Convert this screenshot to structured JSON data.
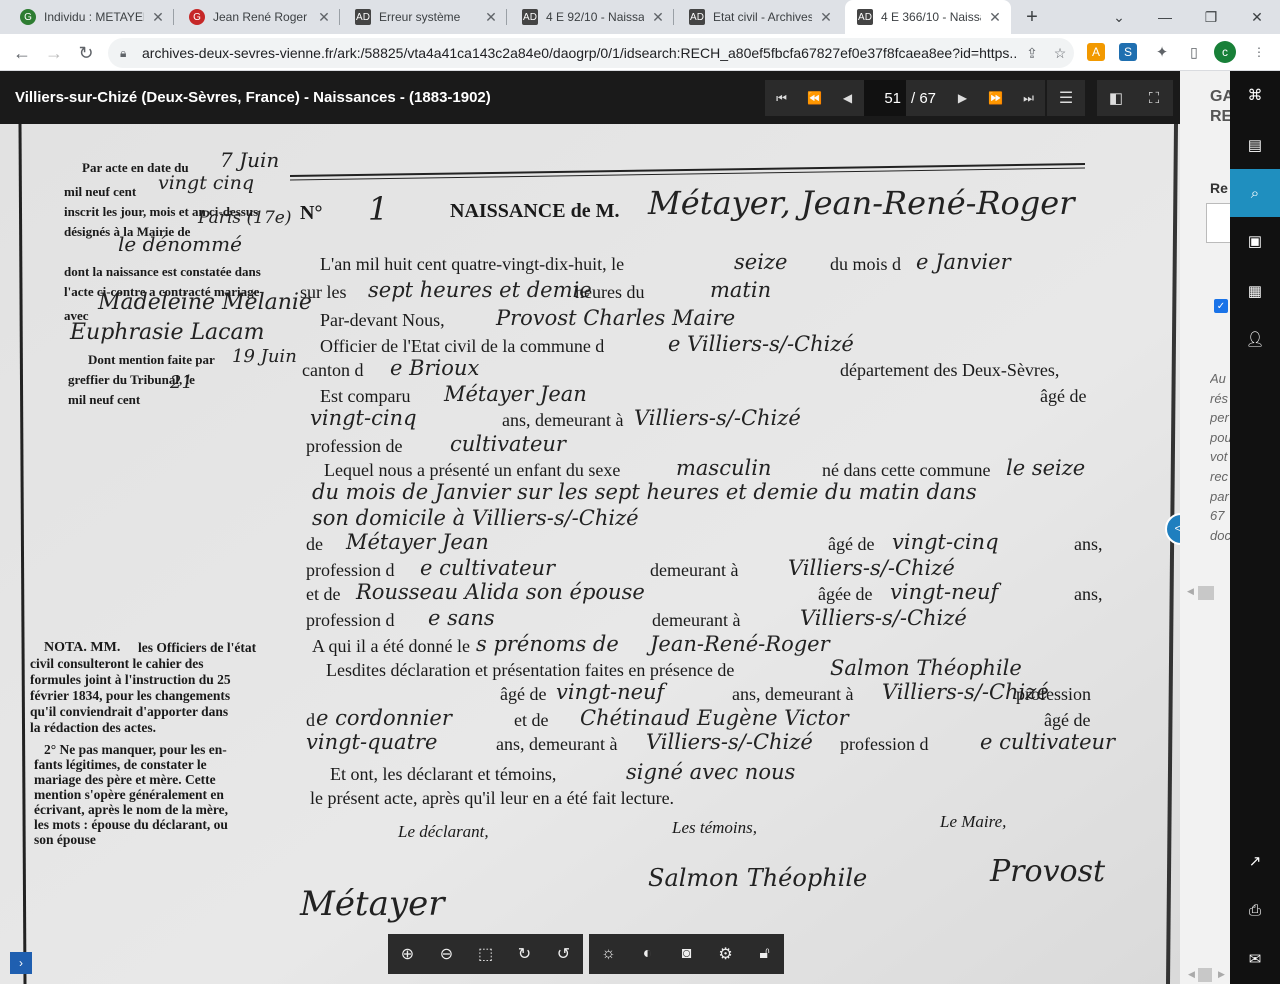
{
  "tabs": [
    {
      "title": "Individu : METAYER",
      "favicon": "geneanet-green-icon"
    },
    {
      "title": "Jean René Roger M",
      "favicon": "geneanet-red-icon"
    },
    {
      "title": "Erreur système",
      "favicon": "archive-doc-icon"
    },
    {
      "title": "4 E 92/10 - Naissan",
      "favicon": "archive-doc-icon"
    },
    {
      "title": "Etat civil - Archives",
      "favicon": "archive-doc-icon"
    },
    {
      "title": "4 E 366/10 - Naissa",
      "favicon": "archive-doc-icon",
      "active": true
    }
  ],
  "address_bar": {
    "url": "archives-deux-sevres-vienne.fr/ark:/58825/vta4a41ca143c2a84e0/daogrp/0/1/idsearch:RECH_a80ef5fbcfa67827ef0e37f8fcaea8ee?id=https...",
    "profile_initial": "c"
  },
  "viewer": {
    "title": "Villiers-sur-Chizé (Deux-Sèvres, France) - Naissances - (1883-1902)",
    "current_page": "51",
    "total_pages": "/ 67"
  },
  "document": {
    "margin_text_top": [
      "Par acte en date du",
      "mil neuf cent",
      "inscrit les jour, mois et an ci-dessus",
      "désignés à la Mairie de",
      "dont la naissance est constatée dans",
      "l'acte ci-contre a contracté mariage",
      "avec",
      "Dont mention faite par",
      "greffier du Tribunal, le",
      "mil neuf cent"
    ],
    "margin_handwriting": [
      "7 Juin",
      "vingt cinq",
      "Paris (17e)",
      "le dénommé",
      "Madeleine Mélanie",
      "Euphrasie Lacam",
      "19 Juin",
      "21"
    ],
    "nota_title": "NOTA. MM.",
    "nota_text": [
      "les Officiers de l'état",
      "civil consulteront le cahier des",
      "formules joint à l'instruction du 25",
      "février 1834, pour les changements",
      "qu'il conviendrait d'apporter dans",
      "la rédaction des actes.",
      "2° Ne pas manquer, pour les en-",
      "fants légitimes, de constater le",
      "mariage des père et mère. Cette",
      "mention s'opère généralement en",
      "écrivant, après le nom de la mère,",
      "les mots : épouse du déclarant, ou",
      "son épouse"
    ],
    "act_number": "1",
    "header": "NAISSANCE de M.",
    "name_hand": "Métayer, Jean-René-Roger",
    "lines": [
      {
        "printed": "L'an mil huit cent quatre-vingt-dix-huit, le",
        "hand": "seize",
        "printed2": "du mois d",
        "hand2": "e Janvier"
      },
      {
        "printed": "sur les",
        "hand": "sept heures et demie",
        "printed2": "heures du",
        "hand2": "matin"
      },
      {
        "printed": "Par-devant Nous,",
        "hand": "Provost Charles Maire"
      },
      {
        "printed": "Officier de l'Etat civil de la commune d",
        "hand": "e Villiers-s/-Chizé"
      },
      {
        "printed": "canton d",
        "hand": "e Brioux",
        "printed2": "département des Deux-Sèvres,"
      },
      {
        "printed": "Est comparu",
        "hand": "Métayer Jean",
        "printed2": "âgé de"
      },
      {
        "printed": "ans, demeurant à",
        "hand": "vingt-cinq",
        "hand2": "Villiers-s/-Chizé"
      },
      {
        "printed": "profession de",
        "hand": "cultivateur"
      },
      {
        "printed": "Lequel nous a présenté un enfant du sexe",
        "hand": "masculin",
        "printed2": "né dans cette commune",
        "hand2": "le seize"
      },
      {
        "hand": "du mois de Janvier sur les sept heures et demie du matin dans"
      },
      {
        "hand": "son domicile à Villiers-s/-Chizé"
      },
      {
        "printed": "de",
        "hand": "Métayer Jean",
        "printed2": "âgé de",
        "hand2": "vingt-cinq",
        "printed3": "ans,"
      },
      {
        "printed": "profession d",
        "hand": "e cultivateur",
        "printed2": "demeurant à",
        "hand2": "Villiers-s/-Chizé"
      },
      {
        "printed": "et de",
        "hand": "Rousseau Alida son épouse",
        "printed2": "âgée de",
        "hand2": "vingt-neuf",
        "printed3": "ans,"
      },
      {
        "printed": "profession d",
        "hand": "e sans",
        "printed2": "demeurant à",
        "hand2": "Villiers-s/-Chizé"
      },
      {
        "printed": "A qui il a été donné le",
        "hand": "s prénoms de",
        "hand2": "Jean-René-Roger"
      },
      {
        "printed": "Lesdites déclaration et présentation faites en présence de",
        "hand": "Salmon Théophile"
      },
      {
        "printed": "âgé de",
        "hand": "vingt-neuf",
        "printed2": "ans, demeurant à",
        "hand2": "Villiers-s/-Chizé",
        "printed3": "profession"
      },
      {
        "printed": "d",
        "hand": "e cordonnier",
        "printed2": "et de",
        "hand2": "Chétinaud Eugène Victor",
        "printed3": "âgé de"
      },
      {
        "hand": "vingt-quatre",
        "printed": "ans, demeurant à",
        "hand2": "Villiers-s/-Chizé",
        "printed2": "profession d",
        "hand3": "e cultivateur"
      },
      {
        "printed": "Et ont, les déclarant et témoins,",
        "hand": "signé avec nous"
      },
      {
        "printed": "le présent acte, après qu'il leur en a été fait lecture."
      }
    ],
    "sign_labels": {
      "declarant": "Le déclarant,",
      "temoins": "Les témoins,",
      "maire": "Le Maire,"
    },
    "signatures": {
      "declarant": "Métayer",
      "temoin": "Salmon Théophile",
      "maire": "Provost"
    }
  },
  "side_panel": {
    "title": "GA ET RE",
    "label": "Re",
    "paragraph": [
      "Au",
      "rés",
      "per",
      "pou",
      "vot",
      "rec",
      "par",
      "67",
      "doc"
    ]
  },
  "icons": {
    "page_first": "first-page-icon",
    "page_prev_fast": "fast-rewind-icon",
    "page_prev": "prev-icon",
    "page_next": "next-icon",
    "page_next_fast": "fast-forward-icon",
    "page_last": "last-page-icon"
  },
  "colors": {
    "accent": "#1f8fbf",
    "viewer_bg": "#1a1a1a"
  }
}
